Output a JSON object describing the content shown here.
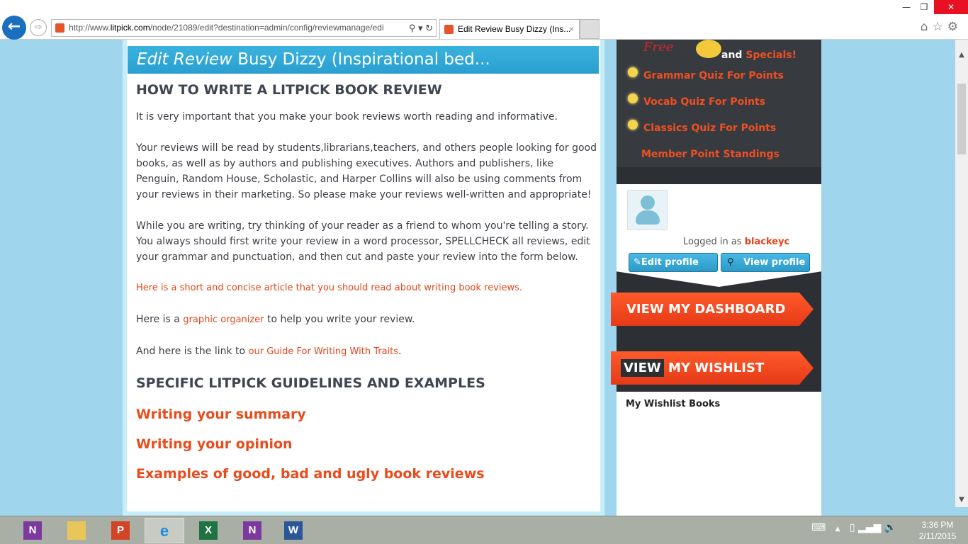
{
  "browser": {
    "url_prefix": "http://www.",
    "url_domain": "litpick.com",
    "url_rest": "/node/21089/edit?destination=admin/config/reviewmanage/edi",
    "tab_title": "Edit Review Busy Dizzy (Ins...",
    "tab_close": "×"
  },
  "page": {
    "header_italic": "Edit Review",
    "header_rest": " Busy Dizzy (Inspirational bed...",
    "h_howto": "HOW TO WRITE A LITPICK BOOK REVIEW",
    "p1": "It is very important that you make your book reviews worth reading and informative.",
    "p2": "Your reviews will be read by students,librarians,teachers, and others people looking for good books, as well as by authors and publishing executives. Authors and publishers, like Penguin, Random House, Scholastic, and Harper Collins will also be using comments from your reviews in their marketing. So please make your reviews well-written and appropriate!",
    "p3": "While you are writing, try thinking of your reader as a friend to whom you're telling a story. You always should first write your review in a word processor, SPELLCHECK all reviews, edit your grammar and punctuation, and then cut and paste your review into the form below.",
    "article_link": "Here is a short and concise article that you should read about writing book reviews.",
    "p5_pre": "Here is a ",
    "p5_link": "graphic organizer",
    "p5_post": " to help you write your review.",
    "p6_pre": "And here is the link to ",
    "p6_link": "our Guide For Writing With Traits",
    "p6_post": ".",
    "h_specific": "SPECIFIC LITPICK GUIDELINES AND EXAMPLES",
    "sections": [
      "Writing your summary",
      "Writing your opinion",
      "Examples of good, bad and ugly book reviews"
    ]
  },
  "sidebar": {
    "free": "Free",
    "and": "and ",
    "specials": "Specials!",
    "quizzes": [
      "Grammar Quiz For Points",
      "Vocab Quiz For Points",
      "Classics Quiz For Points"
    ],
    "standings": "Member Point Standings",
    "logged_in_as": "Logged in as ",
    "username": "blackeyc",
    "edit_profile": "Edit profile",
    "view_profile": "View profile",
    "dashboard": "VIEW MY DASHBOARD",
    "wishlist_view": "VIEW",
    "wishlist_rest": " MY WISHLIST",
    "wishlist_books": "My Wishlist Books"
  },
  "taskbar": {
    "apps": [
      "onenote",
      "file-explorer",
      "powerpoint",
      "internet-explorer",
      "excel",
      "onenote-clipper",
      "word"
    ],
    "time": "3:36 PM",
    "date": "2/11/2015"
  },
  "colors": {
    "accent": "#ef4f22",
    "header": "#2fa5d6",
    "sidebar": "#373b40"
  }
}
